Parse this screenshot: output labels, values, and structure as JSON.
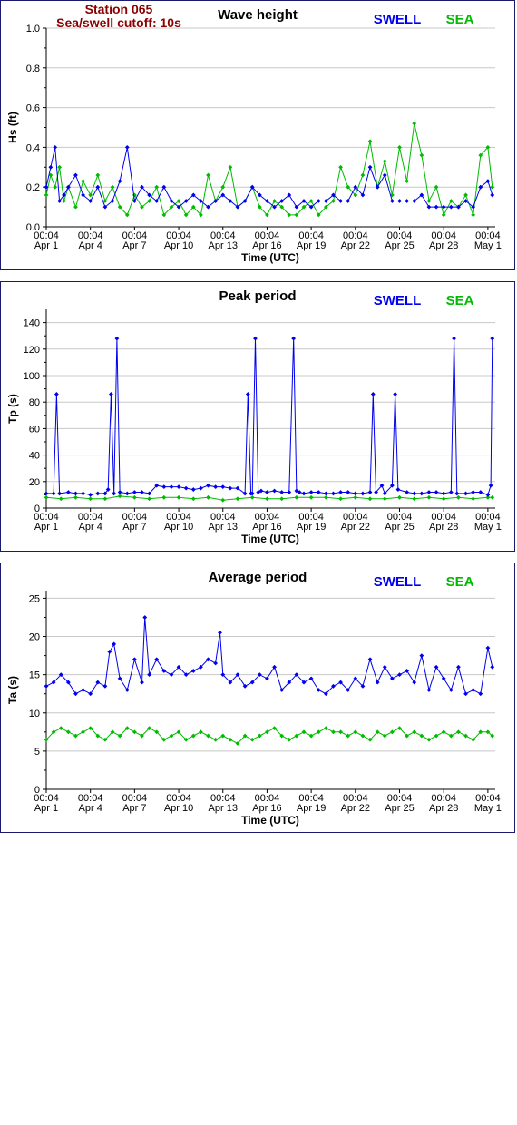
{
  "station": {
    "name": "Station 065",
    "cutoff": "Sea/swell cutoff: 10s"
  },
  "colors": {
    "swell": "#0000ee",
    "sea": "#00bb00",
    "grid": "#c8c8c8",
    "panel_border": "#1a1a6e"
  },
  "legend": {
    "swell": "SWELL",
    "sea": "SEA"
  },
  "x_axis": {
    "label": "Time (UTC)",
    "tick_time": "00:04",
    "tick_dates": [
      "Apr 1",
      "Apr 4",
      "Apr 7",
      "Apr 10",
      "Apr 13",
      "Apr 16",
      "Apr 19",
      "Apr 22",
      "Apr 25",
      "Apr 28",
      "May 1"
    ],
    "start": "Apr 1 00:04",
    "end": "May 1 12:00"
  },
  "chart_data": [
    {
      "type": "line",
      "title": "Wave height",
      "ylabel": "Hs (ft)",
      "ylim": [
        0,
        1.0
      ],
      "yticks": [
        "0.0",
        "0.2",
        "0.4",
        "0.6",
        "0.8",
        "1.0"
      ],
      "grid": true,
      "legend_position": "top-right",
      "x_unit": "days since Apr 1 00:04",
      "series": [
        {
          "name": "SWELL",
          "x": [
            0.0,
            0.3,
            0.6,
            0.9,
            1.2,
            1.5,
            2.0,
            2.5,
            3.0,
            3.5,
            4.0,
            4.5,
            5.0,
            5.5,
            6.0,
            6.5,
            7.0,
            7.5,
            8.0,
            8.5,
            9.0,
            9.5,
            10.0,
            10.5,
            11.0,
            11.5,
            12.0,
            12.5,
            13.0,
            13.5,
            14.0,
            14.5,
            15.0,
            15.5,
            16.0,
            16.5,
            17.0,
            17.5,
            18.0,
            18.5,
            19.0,
            19.5,
            20.0,
            20.5,
            21.0,
            21.5,
            22.0,
            22.5,
            23.0,
            23.5,
            24.0,
            24.5,
            25.0,
            25.5,
            26.0,
            26.5,
            27.0,
            27.5,
            28.0,
            28.5,
            29.0,
            29.5,
            30.0,
            30.3
          ],
          "values": [
            0.2,
            0.3,
            0.4,
            0.13,
            0.16,
            0.2,
            0.26,
            0.16,
            0.13,
            0.2,
            0.1,
            0.13,
            0.23,
            0.4,
            0.13,
            0.2,
            0.16,
            0.13,
            0.2,
            0.13,
            0.1,
            0.13,
            0.16,
            0.13,
            0.1,
            0.13,
            0.16,
            0.13,
            0.1,
            0.13,
            0.2,
            0.16,
            0.13,
            0.1,
            0.13,
            0.16,
            0.1,
            0.13,
            0.1,
            0.13,
            0.13,
            0.16,
            0.13,
            0.13,
            0.2,
            0.16,
            0.3,
            0.2,
            0.26,
            0.13,
            0.13,
            0.13,
            0.13,
            0.16,
            0.1,
            0.1,
            0.1,
            0.1,
            0.1,
            0.13,
            0.1,
            0.2,
            0.23,
            0.16
          ]
        },
        {
          "name": "SEA",
          "x": [
            0.0,
            0.3,
            0.6,
            0.9,
            1.2,
            1.5,
            2.0,
            2.5,
            3.0,
            3.5,
            4.0,
            4.5,
            5.0,
            5.5,
            6.0,
            6.5,
            7.0,
            7.5,
            8.0,
            8.5,
            9.0,
            9.5,
            10.0,
            10.5,
            11.0,
            11.5,
            12.0,
            12.5,
            13.0,
            13.5,
            14.0,
            14.5,
            15.0,
            15.5,
            16.0,
            16.5,
            17.0,
            17.5,
            18.0,
            18.5,
            19.0,
            19.5,
            20.0,
            20.5,
            21.0,
            21.5,
            22.0,
            22.5,
            23.0,
            23.5,
            24.0,
            24.5,
            25.0,
            25.5,
            26.0,
            26.5,
            27.0,
            27.5,
            28.0,
            28.5,
            29.0,
            29.5,
            30.0,
            30.3
          ],
          "values": [
            0.16,
            0.26,
            0.2,
            0.3,
            0.13,
            0.2,
            0.1,
            0.23,
            0.16,
            0.26,
            0.13,
            0.2,
            0.1,
            0.06,
            0.16,
            0.1,
            0.13,
            0.2,
            0.06,
            0.1,
            0.13,
            0.06,
            0.1,
            0.06,
            0.26,
            0.13,
            0.2,
            0.3,
            0.1,
            0.13,
            0.2,
            0.1,
            0.06,
            0.13,
            0.1,
            0.06,
            0.06,
            0.1,
            0.13,
            0.06,
            0.1,
            0.13,
            0.3,
            0.2,
            0.16,
            0.26,
            0.43,
            0.2,
            0.33,
            0.16,
            0.4,
            0.23,
            0.52,
            0.36,
            0.13,
            0.2,
            0.06,
            0.13,
            0.1,
            0.16,
            0.06,
            0.36,
            0.4,
            0.2
          ]
        }
      ]
    },
    {
      "type": "line",
      "title": "Peak period",
      "ylabel": "Tp (s)",
      "ylim": [
        0,
        150
      ],
      "yticks": [
        "0",
        "20",
        "40",
        "60",
        "80",
        "100",
        "120",
        "140"
      ],
      "grid": true,
      "legend_position": "top-right",
      "x_unit": "days since Apr 1 00:04",
      "series": [
        {
          "name": "SWELL",
          "x": [
            0.0,
            0.5,
            0.7,
            0.9,
            1.5,
            2.0,
            2.5,
            3.0,
            3.5,
            4.0,
            4.2,
            4.4,
            4.6,
            4.8,
            5.0,
            5.5,
            6.0,
            6.5,
            7.0,
            7.5,
            8.0,
            8.5,
            9.0,
            9.5,
            10.0,
            10.5,
            11.0,
            11.5,
            12.0,
            12.5,
            13.0,
            13.5,
            13.7,
            13.9,
            14.0,
            14.2,
            14.4,
            14.6,
            15.0,
            15.5,
            16.0,
            16.5,
            16.8,
            17.0,
            17.2,
            17.5,
            18.0,
            18.5,
            19.0,
            19.5,
            20.0,
            20.5,
            21.0,
            21.5,
            22.0,
            22.2,
            22.4,
            22.8,
            23.0,
            23.5,
            23.7,
            23.9,
            24.5,
            25.0,
            25.5,
            26.0,
            26.5,
            27.0,
            27.5,
            27.7,
            27.9,
            28.5,
            29.0,
            29.5,
            30.0,
            30.2,
            30.3
          ],
          "values": [
            11,
            11,
            86,
            11,
            12,
            11,
            11,
            10,
            11,
            11,
            14,
            86,
            11,
            128,
            12,
            11,
            12,
            12,
            11,
            17,
            16,
            16,
            16,
            15,
            14,
            15,
            17,
            16,
            16,
            15,
            15,
            11,
            86,
            11,
            11,
            128,
            12,
            13,
            12,
            13,
            12,
            12,
            128,
            13,
            12,
            11,
            12,
            12,
            11,
            11,
            12,
            12,
            11,
            11,
            12,
            86,
            12,
            17,
            11,
            17,
            86,
            14,
            12,
            11,
            11,
            12,
            12,
            11,
            12,
            128,
            11,
            11,
            12,
            12,
            10,
            17,
            128
          ]
        },
        {
          "name": "SEA",
          "x": [
            0.0,
            1.0,
            2.0,
            3.0,
            4.0,
            5.0,
            6.0,
            7.0,
            8.0,
            9.0,
            10.0,
            11.0,
            12.0,
            13.0,
            14.0,
            15.0,
            16.0,
            17.0,
            18.0,
            19.0,
            20.0,
            21.0,
            22.0,
            23.0,
            24.0,
            25.0,
            26.0,
            27.0,
            28.0,
            29.0,
            30.0,
            30.3
          ],
          "values": [
            8,
            7,
            8,
            7,
            7,
            9,
            8,
            7,
            8,
            8,
            7,
            8,
            6,
            7,
            8,
            7,
            7,
            8,
            8,
            8,
            7,
            8,
            7,
            7,
            8,
            7,
            8,
            7,
            8,
            7,
            8,
            8
          ]
        }
      ]
    },
    {
      "type": "line",
      "title": "Average period",
      "ylabel": "Ta (s)",
      "ylim": [
        0,
        26
      ],
      "yticks": [
        "0",
        "5",
        "10",
        "15",
        "20",
        "25"
      ],
      "grid": true,
      "legend_position": "top-right",
      "x_unit": "days since Apr 1 00:04",
      "series": [
        {
          "name": "SWELL",
          "x": [
            0.0,
            0.5,
            1.0,
            1.5,
            2.0,
            2.5,
            3.0,
            3.5,
            4.0,
            4.3,
            4.6,
            5.0,
            5.5,
            6.0,
            6.5,
            6.7,
            7.0,
            7.5,
            8.0,
            8.5,
            9.0,
            9.5,
            10.0,
            10.5,
            11.0,
            11.5,
            11.8,
            12.0,
            12.5,
            13.0,
            13.5,
            14.0,
            14.5,
            15.0,
            15.5,
            16.0,
            16.5,
            17.0,
            17.5,
            18.0,
            18.5,
            19.0,
            19.5,
            20.0,
            20.5,
            21.0,
            21.5,
            22.0,
            22.5,
            23.0,
            23.5,
            24.0,
            24.5,
            25.0,
            25.5,
            26.0,
            26.5,
            27.0,
            27.5,
            28.0,
            28.5,
            29.0,
            29.5,
            30.0,
            30.3
          ],
          "values": [
            13.5,
            14,
            15,
            14,
            12.5,
            13,
            12.5,
            14,
            13.5,
            18,
            19,
            14.5,
            13,
            17,
            14,
            22.5,
            15,
            17,
            15.5,
            15,
            16,
            15,
            15.5,
            16,
            17,
            16.5,
            20.5,
            15,
            14,
            15,
            13.5,
            14,
            15,
            14.5,
            16,
            13,
            14,
            15,
            14,
            14.5,
            13,
            12.5,
            13.5,
            14,
            13,
            14.5,
            13.5,
            17,
            14,
            16,
            14.5,
            15,
            15.5,
            14,
            17.5,
            13,
            16,
            14.5,
            13,
            16,
            12.5,
            13,
            12.5,
            18.5,
            16
          ]
        },
        {
          "name": "SEA",
          "x": [
            0.0,
            0.5,
            1.0,
            1.5,
            2.0,
            2.5,
            3.0,
            3.5,
            4.0,
            4.5,
            5.0,
            5.5,
            6.0,
            6.5,
            7.0,
            7.5,
            8.0,
            8.5,
            9.0,
            9.5,
            10.0,
            10.5,
            11.0,
            11.5,
            12.0,
            12.5,
            13.0,
            13.5,
            14.0,
            14.5,
            15.0,
            15.5,
            16.0,
            16.5,
            17.0,
            17.5,
            18.0,
            18.5,
            19.0,
            19.5,
            20.0,
            20.5,
            21.0,
            21.5,
            22.0,
            22.5,
            23.0,
            23.5,
            24.0,
            24.5,
            25.0,
            25.5,
            26.0,
            26.5,
            27.0,
            27.5,
            28.0,
            28.5,
            29.0,
            29.5,
            30.0,
            30.3
          ],
          "values": [
            6.5,
            7.5,
            8,
            7.5,
            7,
            7.5,
            8,
            7,
            6.5,
            7.5,
            7,
            8,
            7.5,
            7,
            8,
            7.5,
            6.5,
            7,
            7.5,
            6.5,
            7,
            7.5,
            7,
            6.5,
            7,
            6.5,
            6,
            7,
            6.5,
            7,
            7.5,
            8,
            7,
            6.5,
            7,
            7.5,
            7,
            7.5,
            8,
            7.5,
            7.5,
            7,
            7.5,
            7,
            6.5,
            7.5,
            7,
            7.5,
            8,
            7,
            7.5,
            7,
            6.5,
            7,
            7.5,
            7,
            7.5,
            7,
            6.5,
            7.5,
            7.5,
            7
          ]
        }
      ]
    }
  ]
}
